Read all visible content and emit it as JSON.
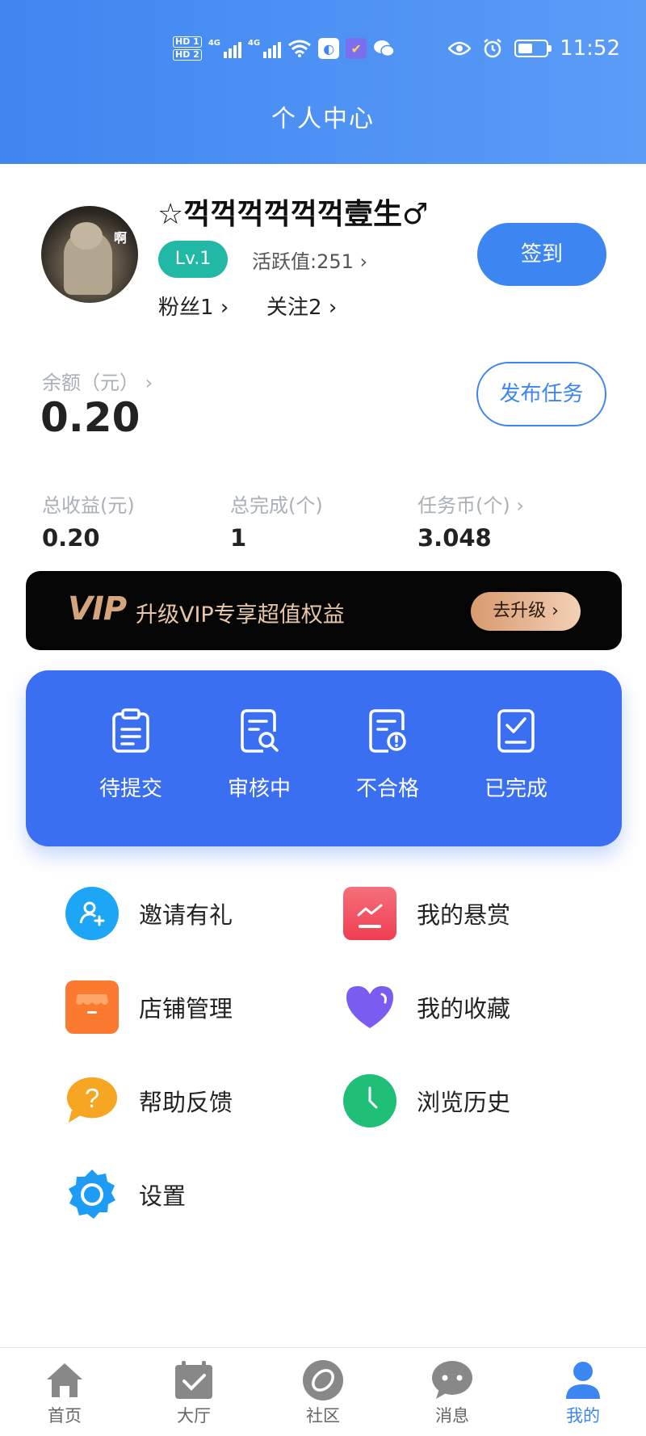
{
  "status_bar": {
    "network_1": "HD 1",
    "network_2": "HD 2",
    "signal_1": "4G",
    "signal_2": "4G",
    "time": "11:52",
    "icons": [
      "wifi-icon",
      "app-icon",
      "task-app-icon",
      "wechat-icon",
      "eye-icon",
      "alarm-icon",
      "battery-icon"
    ]
  },
  "header": {
    "title": "个人中心"
  },
  "profile": {
    "username": "☆꺽꺽꺽꺽꺽꺽壹生♂",
    "avatar_text": "啊",
    "level": "Lv.1",
    "activity": "活跃值:251",
    "fans": "粉丝1",
    "following": "关注2",
    "signin_label": "签到"
  },
  "balance": {
    "label": "余额（元）",
    "value": "0.20",
    "publish_label": "发布任务"
  },
  "stats": [
    {
      "label": "总收益(元)",
      "value": "0.20"
    },
    {
      "label": "总完成(个)",
      "value": "1"
    },
    {
      "label": "任务币(个)",
      "value": "3.048"
    }
  ],
  "vip": {
    "logo": "VIP",
    "text": "升级VIP专享超值权益",
    "button": "去升级"
  },
  "tasks": [
    {
      "label": "待提交",
      "icon": "clipboard-icon"
    },
    {
      "label": "审核中",
      "icon": "document-search-icon"
    },
    {
      "label": "不合格",
      "icon": "document-alert-icon"
    },
    {
      "label": "已完成",
      "icon": "document-check-icon"
    }
  ],
  "menu": [
    {
      "label": "邀请有礼",
      "icon": "invite-icon",
      "color": "#1da6f5"
    },
    {
      "label": "我的悬赏",
      "icon": "reward-icon",
      "color": "#f24c5c"
    },
    {
      "label": "店铺管理",
      "icon": "store-icon",
      "color": "#fb7a2f"
    },
    {
      "label": "我的收藏",
      "icon": "heart-icon",
      "color": "#7a5cf0"
    },
    {
      "label": "帮助反馈",
      "icon": "help-icon",
      "color": "#f6a623"
    },
    {
      "label": "浏览历史",
      "icon": "clock-icon",
      "color": "#20bf78"
    },
    {
      "label": "设置",
      "icon": "gear-icon",
      "color": "#1d9bf5"
    }
  ],
  "tabbar": [
    {
      "label": "首页",
      "icon": "home-icon"
    },
    {
      "label": "大厅",
      "icon": "calendar-check-icon"
    },
    {
      "label": "社区",
      "icon": "community-icon"
    },
    {
      "label": "消息",
      "icon": "chat-icon"
    },
    {
      "label": "我的",
      "icon": "user-icon",
      "active": true
    }
  ],
  "colors": {
    "primary": "#3d86f1",
    "task_panel": "#3b6ff2",
    "level_badge": "#22b8a6"
  }
}
